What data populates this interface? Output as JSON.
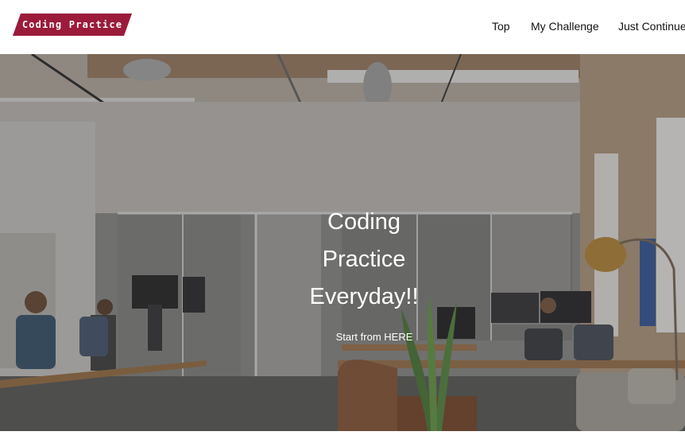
{
  "header": {
    "logo_text": "Coding Practice",
    "logo_color": "#9b1b3a",
    "nav": [
      {
        "label": "Top"
      },
      {
        "label": "My Challenge"
      },
      {
        "label": "Just Continue"
      }
    ]
  },
  "hero": {
    "title_lines": [
      "Coding",
      "Practice",
      "Everyday!!"
    ],
    "cta": "Start from HERE",
    "background_image": "open-plan office with people working at desks"
  }
}
